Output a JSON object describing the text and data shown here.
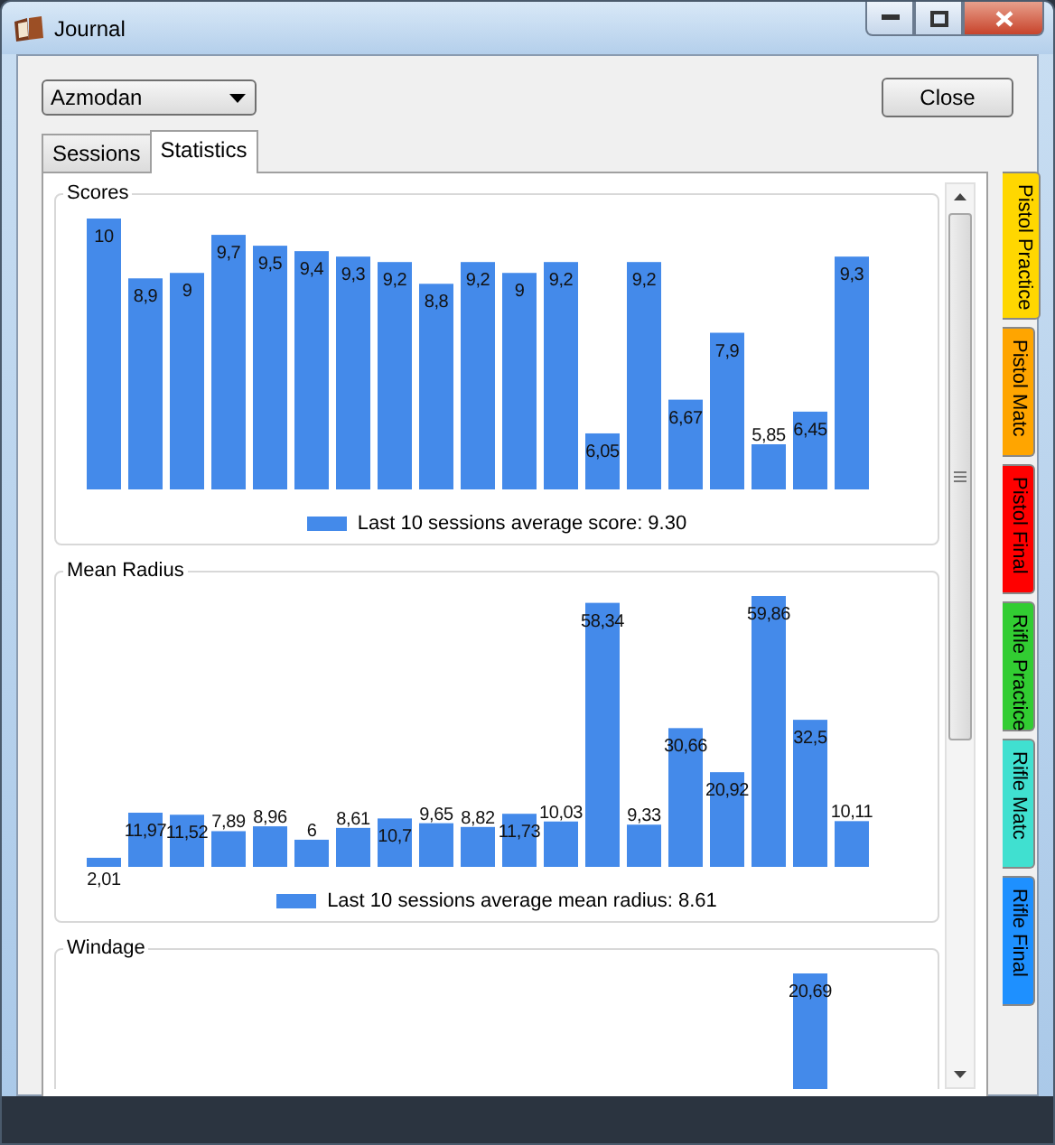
{
  "window": {
    "title": "Journal"
  },
  "shooter_select": {
    "value": "Azmodan"
  },
  "close_button": "Close",
  "tabs": [
    {
      "label": "Sessions",
      "selected": false
    },
    {
      "label": "Statistics",
      "selected": true
    }
  ],
  "groups": [
    {
      "title": "Scores",
      "bar_labels": [
        "10",
        "8,9",
        "9",
        "9,7",
        "9,5",
        "9,4",
        "9,3",
        "9,2",
        "8,8",
        "9,2",
        "9",
        "9,2",
        "6,05",
        "9,2",
        "6,67",
        "7,9",
        "5,85",
        "6,45",
        "9,3"
      ],
      "legend": "Last 10 sessions average score: 9.30"
    },
    {
      "title": "Mean Radius",
      "bar_labels": [
        "2,01",
        "11,97",
        "11,52",
        "7,89",
        "8,96",
        "6",
        "8,61",
        "10,7",
        "9,65",
        "8,82",
        "11,73",
        "10,03",
        "58,34",
        "9,33",
        "30,66",
        "20,92",
        "59,86",
        "32,5",
        "10,11"
      ],
      "legend": "Last 10 sessions average mean radius: 8.61"
    },
    {
      "title": "Windage",
      "bar_label": "20,69"
    }
  ],
  "side_tabs": [
    {
      "label": "Pistol Practice",
      "color": "#ffd700",
      "selected": true
    },
    {
      "label": "Pistol Matc",
      "color": "#ffa500",
      "selected": false
    },
    {
      "label": "Pistol Final",
      "color": "#ff0000",
      "selected": false
    },
    {
      "label": "Rifle Practice",
      "color": "#32cd32",
      "selected": false
    },
    {
      "label": "Rifle Matc",
      "color": "#40e0d0",
      "selected": false
    },
    {
      "label": "Rifle Final",
      "color": "#1e90ff",
      "selected": false
    }
  ]
}
